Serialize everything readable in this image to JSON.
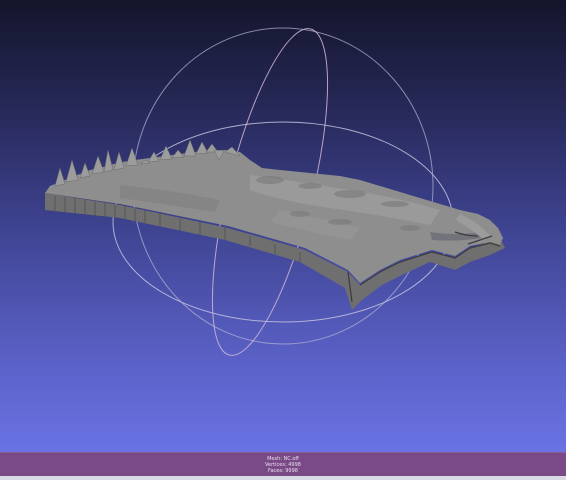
{
  "viewer": {
    "background_top": "#14152b",
    "background_bottom": "#6f78ee",
    "trackball_color": "#c9c6e0",
    "mesh_color": "#8c8c8c"
  },
  "info": {
    "mesh": "Mesh: NC.off",
    "vertices": "Vertices: 4998",
    "faces": "Faces: 9998"
  }
}
